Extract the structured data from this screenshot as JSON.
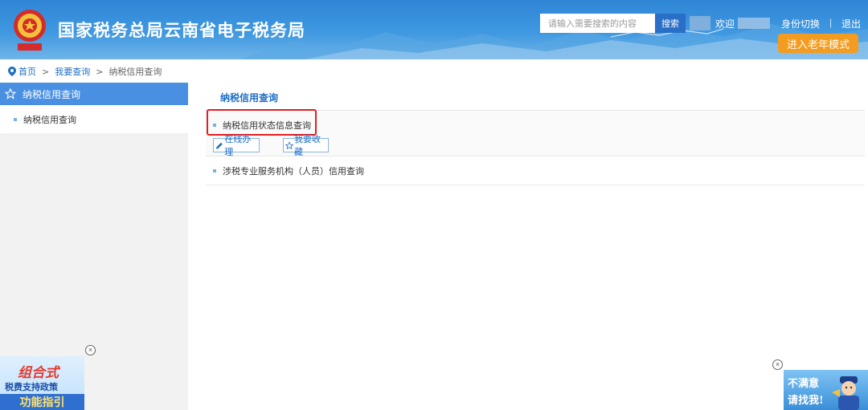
{
  "header": {
    "site_title": "国家税务总局云南省电子税务局",
    "search_placeholder": "请输入需要搜索的内容",
    "search_button": "搜索",
    "welcome": "欢迎",
    "identity_switch": "身份切换",
    "separator": "|",
    "logout": "退出",
    "elder_mode": "进入老年模式"
  },
  "breadcrumb": {
    "home": "首页",
    "sep": ">",
    "level1": "我要查询",
    "level2": "纳税信用查询"
  },
  "sidebar": {
    "title": "纳税信用查询",
    "items": [
      {
        "label": "纳税信用查询"
      }
    ]
  },
  "main": {
    "section_title": "纳税信用查询",
    "items": [
      {
        "label": "纳税信用状态信息查询",
        "highlighted": true,
        "actions": [
          {
            "label": "在线办理",
            "icon": "pencil-icon"
          },
          {
            "label": "我要收藏",
            "icon": "star-icon"
          }
        ]
      },
      {
        "label": "涉税专业服务机构（人员）信用查询"
      }
    ]
  },
  "floats": {
    "left_banner": {
      "line1": "组合式",
      "line2": "税费支持政策",
      "line3": "功能指引"
    },
    "right_banner": {
      "line1": "不满意",
      "line2": "请找我!"
    },
    "close_glyph": "×"
  },
  "colors": {
    "header_blue": "#3f98e0",
    "accent_blue": "#4a90e2",
    "link_blue": "#1f6fc5",
    "elder_orange": "#f39c1f",
    "highlight_red": "#e02020"
  }
}
